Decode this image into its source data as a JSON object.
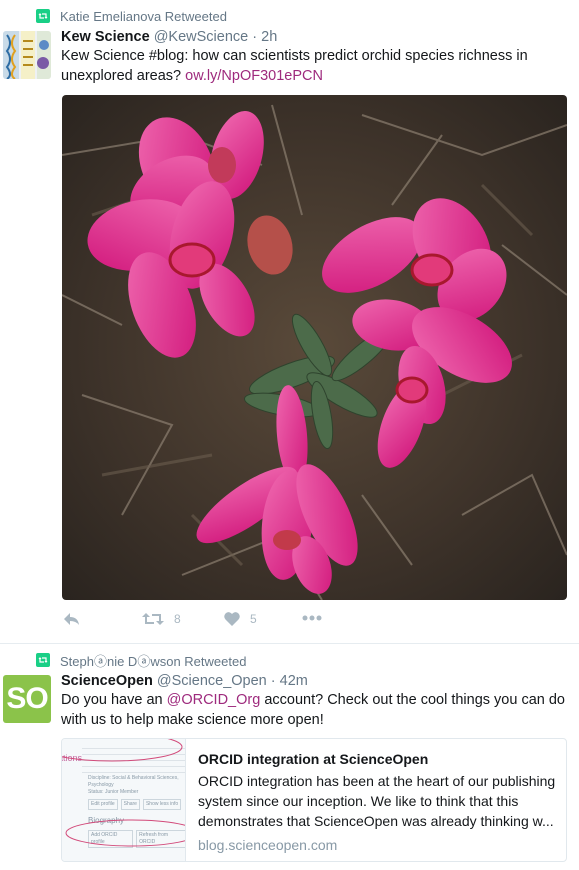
{
  "colors": {
    "retweet_green": "#19cf86",
    "link": "#9e2a7d",
    "muted": "#657786",
    "action_gray": "#aab8c2",
    "sciopen_green": "#8bc34a"
  },
  "tweet1": {
    "retweeted_by": "Katie Emelianova Retweeted",
    "author_name": "Kew Science",
    "author_handle": "@KewScience",
    "separator": "·",
    "time": "2h",
    "text_plain": "Kew Science #blog: how can scientists predict orchid species richness in unexplored areas?",
    "link": "ow.ly/NpOF301ePCN",
    "photo_icon": "orchid-photo",
    "actions": {
      "reply_icon": "reply-icon",
      "retweet_icon": "retweet-icon",
      "retweet_count": "8",
      "like_icon": "heart-icon",
      "like_count": "5",
      "more_icon": "more-icon"
    }
  },
  "tweet2": {
    "retweeted_by": "Stephⓐnie Dⓐwson Retweeted",
    "author_name": "ScienceOpen",
    "author_handle": "@Science_Open",
    "separator": "·",
    "time": "42m",
    "avatar_text": "SO",
    "text_before": "Do you have an ",
    "mention": "@ORCID_Org",
    "text_after": " account?  Check out the cool things you can do with us to help make science more open!",
    "card": {
      "title": "ORCID integration at ScienceOpen",
      "description": "ORCID integration has been at the heart of our publishing system since our inception. We like to think that this demonstrates that ScienceOpen was already thinking w...",
      "domain": "blog.scienceopen.com",
      "thumb_labels": {
        "section": "ations",
        "biography": "Biography",
        "btn_edit": "Edit profile",
        "btn_share": "Share",
        "btn_full": "Show less info",
        "btn_orcid": "Add ORCID profile",
        "btn_refresh": "Refresh from ORCID",
        "discipline": "Discipline: Social & Behavioral Sciences, Psychology",
        "status": "Status: Junior Member"
      }
    }
  }
}
